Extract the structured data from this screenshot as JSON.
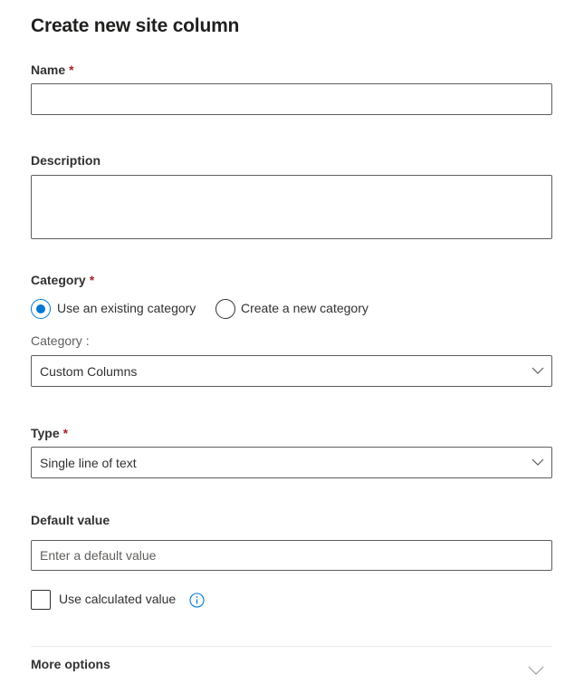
{
  "panel": {
    "title": "Create new site column"
  },
  "name": {
    "label": "Name",
    "required_mark": "*",
    "value": ""
  },
  "description": {
    "label": "Description",
    "value": ""
  },
  "category": {
    "label": "Category",
    "required_mark": "*",
    "options": [
      {
        "label": "Use an existing category",
        "selected": true
      },
      {
        "label": "Create a new category",
        "selected": false
      }
    ],
    "sublabel": "Category :",
    "selected_value": "Custom Columns"
  },
  "type": {
    "label": "Type",
    "required_mark": "*",
    "selected_value": "Single line of text"
  },
  "default_value": {
    "label": "Default value",
    "placeholder": "Enter a default value"
  },
  "calculated": {
    "label": "Use calculated value",
    "checked": false,
    "info_icon": "info-icon"
  },
  "more_options": {
    "label": "More options",
    "icon": "chevron-down-icon"
  },
  "colors": {
    "accent": "#0078d4",
    "required": "#a4262c",
    "border": "#605e5c",
    "divider": "#edebe9"
  }
}
